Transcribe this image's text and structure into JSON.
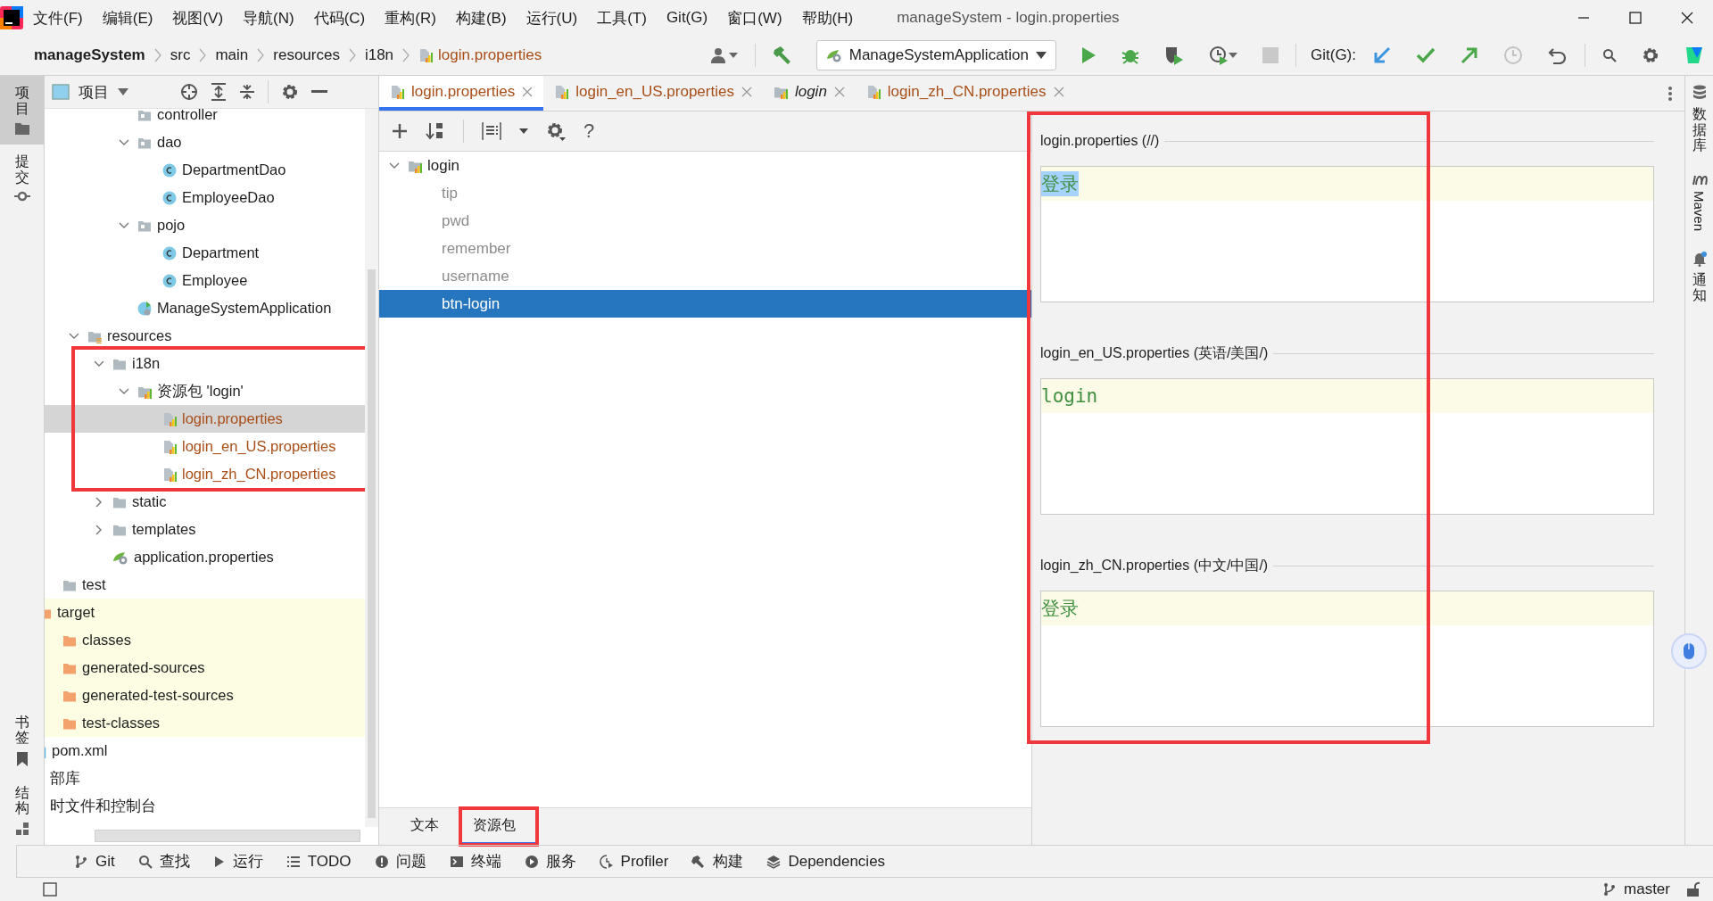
{
  "menu": {
    "items": [
      "文件(F)",
      "编辑(E)",
      "视图(V)",
      "导航(N)",
      "代码(C)",
      "重构(R)",
      "构建(B)",
      "运行(U)",
      "工具(T)",
      "Git(G)",
      "窗口(W)",
      "帮助(H)"
    ]
  },
  "window": {
    "title": "manageSystem - login.properties"
  },
  "breadcrumb": [
    {
      "label": "manageSystem",
      "kind": "project"
    },
    {
      "label": "src",
      "kind": "dir"
    },
    {
      "label": "main",
      "kind": "dir"
    },
    {
      "label": "resources",
      "kind": "dir"
    },
    {
      "label": "i18n",
      "kind": "dir"
    },
    {
      "label": "login.properties",
      "kind": "properties"
    }
  ],
  "run_config": {
    "label": "ManageSystemApplication"
  },
  "git": {
    "label": "Git(G):"
  },
  "left_strip": {
    "top": [
      {
        "label": "项目",
        "kind": "project",
        "selected": true
      },
      {
        "label": "提交",
        "kind": "commit",
        "selected": false
      }
    ],
    "bottom": [
      {
        "label": "书签",
        "kind": "bookmark",
        "selected": false
      },
      {
        "label": "结构",
        "kind": "structure",
        "selected": false
      }
    ]
  },
  "project_panel": {
    "title": "项目",
    "tree": [
      {
        "children": [
          {
            "children": [
              {
                "children": [
                  {
                    "children": [
                      {
                        "label": "controller",
                        "kind": "package",
                        "selected": false
                      },
                      {
                        "label": "dao",
                        "kind": "package",
                        "expanded": true,
                        "selected": false,
                        "children": [
                          {
                            "label": "DepartmentDao",
                            "kind": "class",
                            "selected": false
                          },
                          {
                            "label": "EmployeeDao",
                            "kind": "class",
                            "selected": false
                          }
                        ]
                      },
                      {
                        "label": "pojo",
                        "kind": "package",
                        "expanded": true,
                        "selected": false,
                        "children": [
                          {
                            "label": "Department",
                            "kind": "class",
                            "selected": false
                          },
                          {
                            "label": "Employee",
                            "kind": "class",
                            "selected": false
                          }
                        ]
                      },
                      {
                        "label": "ManageSystemApplication",
                        "kind": "spring-class",
                        "selected": false
                      }
                    ]
                  }
                ]
              },
              {
                "label": "resources",
                "kind": "resources",
                "expanded": true,
                "selected": false,
                "children": [
                  {
                    "label": "i18n",
                    "kind": "folder",
                    "expanded": true,
                    "selected": false,
                    "marked": true,
                    "children": [
                      {
                        "label": "资源包 'login'",
                        "kind": "bundle",
                        "expanded": true,
                        "selected": false,
                        "children": [
                          {
                            "label": "login.properties",
                            "kind": "properties",
                            "selected": true
                          },
                          {
                            "label": "login_en_US.properties",
                            "kind": "properties",
                            "selected": false
                          },
                          {
                            "label": "login_zh_CN.properties",
                            "kind": "properties",
                            "selected": false
                          }
                        ]
                      }
                    ]
                  },
                  {
                    "label": "static",
                    "kind": "folder",
                    "expanded": false,
                    "selected": false
                  },
                  {
                    "label": "templates",
                    "kind": "folder",
                    "expanded": false,
                    "selected": false
                  },
                  {
                    "label": "application.properties",
                    "kind": "spring-properties",
                    "selected": false
                  }
                ]
              }
            ]
          },
          {
            "label": "test",
            "kind": "folder",
            "selected": false
          }
        ]
      },
      {
        "label": "target",
        "kind": "excluded",
        "selected": false,
        "children": [
          {
            "label": "classes",
            "kind": "excluded",
            "selected": false
          },
          {
            "label": "generated-sources",
            "kind": "excluded",
            "selected": false
          },
          {
            "label": "generated-test-sources",
            "kind": "excluded",
            "selected": false
          },
          {
            "label": "test-classes",
            "kind": "excluded",
            "selected": false
          }
        ]
      },
      {
        "label": "pom.xml",
        "kind": "pom",
        "selected": false
      },
      {
        "label": "部库",
        "kind": "clipped",
        "selected": false
      },
      {
        "label": "时文件和控制台",
        "kind": "clipped",
        "selected": false
      }
    ]
  },
  "editor": {
    "tabs": [
      {
        "label": "login.properties",
        "kind": "properties",
        "selected": true
      },
      {
        "label": "login_en_US.properties",
        "kind": "properties",
        "selected": false
      },
      {
        "label": "login",
        "kind": "bundle",
        "selected": false
      },
      {
        "label": "login_zh_CN.properties",
        "kind": "properties",
        "selected": false
      }
    ],
    "toolbar": {
      "help": "?"
    },
    "keys": [
      {
        "label": "login",
        "expanded": true,
        "selected": false,
        "children": [
          {
            "label": "tip",
            "selected": false
          },
          {
            "label": "pwd",
            "selected": false
          },
          {
            "label": "remember",
            "selected": false
          },
          {
            "label": "username",
            "selected": false
          },
          {
            "label": "btn-login",
            "selected": true
          }
        ]
      }
    ],
    "values": {
      "marked": true,
      "sections": [
        {
          "title": "login.properties (//)",
          "value": "登录",
          "highlighted": true
        },
        {
          "title": "login_en_US.properties (英语/美国/)",
          "value": "login",
          "highlighted": false
        },
        {
          "title": "login_zh_CN.properties (中文/中国/)",
          "value": "登录",
          "highlighted": false
        }
      ]
    },
    "bottom_tabs": [
      {
        "label": "文本",
        "selected": false,
        "marked": false
      },
      {
        "label": "资源包",
        "selected": true,
        "marked": true
      }
    ]
  },
  "right_strip": [
    {
      "label": "数据库",
      "kind": "database"
    },
    {
      "label": "Maven",
      "kind": "maven"
    },
    {
      "label": "通知",
      "kind": "bell"
    }
  ],
  "tool_windows": [
    {
      "label": "Git",
      "kind": "git"
    },
    {
      "label": "查找",
      "kind": "search"
    },
    {
      "label": "运行",
      "kind": "run"
    },
    {
      "label": "TODO",
      "kind": "todo"
    },
    {
      "label": "问题",
      "kind": "problems"
    },
    {
      "label": "终端",
      "kind": "terminal"
    },
    {
      "label": "服务",
      "kind": "services"
    },
    {
      "label": "Profiler",
      "kind": "profiler"
    },
    {
      "label": "构建",
      "kind": "build"
    },
    {
      "label": "Dependencies",
      "kind": "dependencies"
    }
  ],
  "status_bar": {
    "branch": "master"
  }
}
